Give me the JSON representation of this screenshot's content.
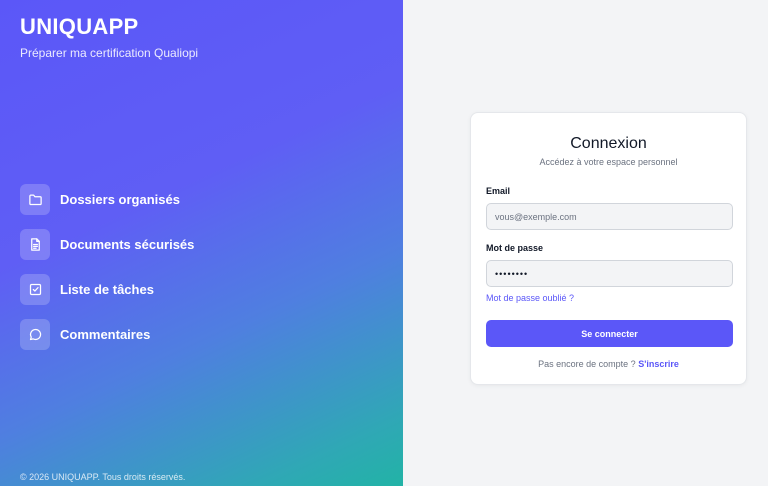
{
  "left_panel": {
    "brand": "UNIQUAPP",
    "tagline": "Préparer ma certification Qualiopi",
    "features": [
      {
        "icon": "folder-icon",
        "label": "Dossiers organisés"
      },
      {
        "icon": "document-icon",
        "label": "Documents sécurisés"
      },
      {
        "icon": "checkbox-icon",
        "label": "Liste de tâches"
      },
      {
        "icon": "comment-icon",
        "label": "Commentaires"
      }
    ],
    "footer": "© 2026 UNIQUAPP. Tous droits réservés."
  },
  "login": {
    "title": "Connexion",
    "subtitle": "Accédez à votre espace personnel",
    "email_label": "Email",
    "email_placeholder": "vous@exemple.com",
    "email_value": "",
    "password_label": "Mot de passe",
    "password_value": "••••••••",
    "forgot_link": "Mot de passe oublié ?",
    "submit_label": "Se connecter",
    "signup_prompt": "Pas encore de compte ?",
    "signup_link": "S'inscrire"
  },
  "colors": {
    "accent": "#5b57f8",
    "gradient_start": "#5b57f8",
    "gradient_end": "#22b3a6",
    "right_bg": "#f3f4f6"
  }
}
